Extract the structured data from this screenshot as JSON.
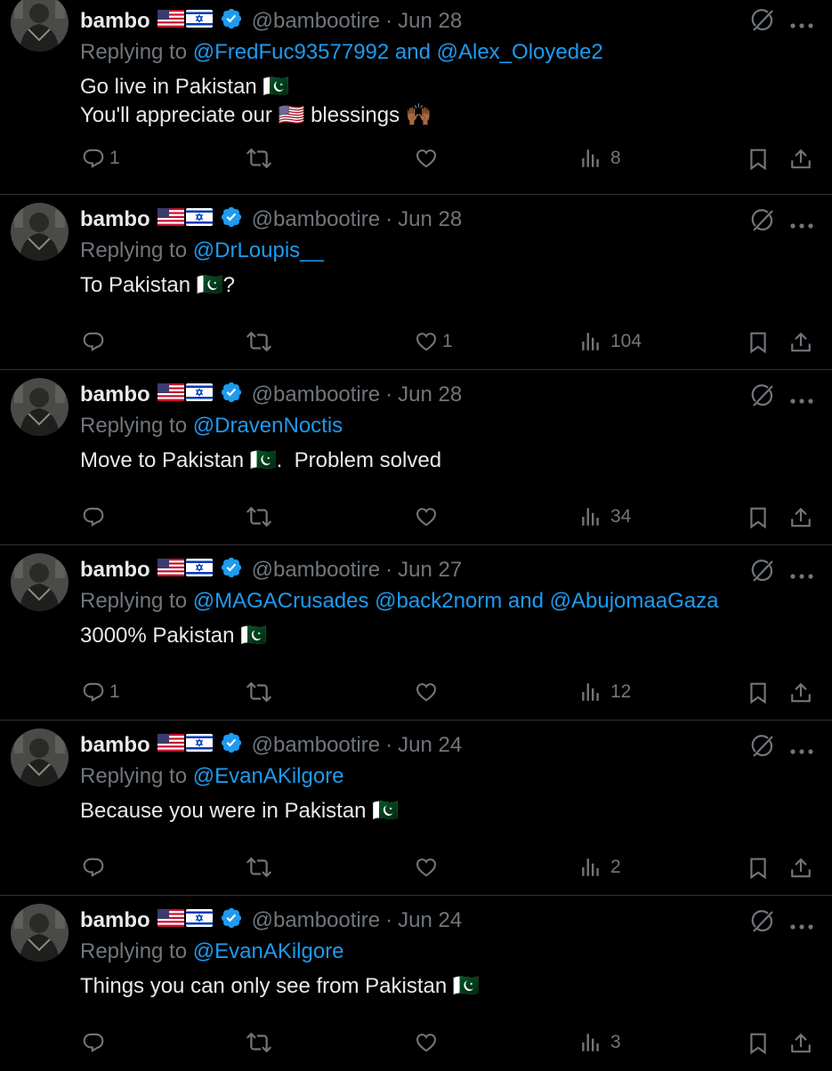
{
  "tweets": [
    {
      "name": "bambo",
      "handle": "@bambootire",
      "separator": "·",
      "date": "Jun 28",
      "replying_prefix": "Replying to",
      "replying_to": "@FredFuc93577992 and @Alex_Oloyede2",
      "body_lines": [
        "Go live in Pakistan 🇵🇰",
        "You'll appreciate our 🇺🇸 blessings 🙌🏾"
      ],
      "counts": {
        "replies": "1",
        "retweets": "",
        "likes": "",
        "views": "8"
      }
    },
    {
      "name": "bambo",
      "handle": "@bambootire",
      "separator": "·",
      "date": "Jun 28",
      "replying_prefix": "Replying to",
      "replying_to": "@DrLoupis__",
      "body_lines": [
        "To Pakistan 🇵🇰?"
      ],
      "counts": {
        "replies": "",
        "retweets": "",
        "likes": "1",
        "views": "104"
      }
    },
    {
      "name": "bambo",
      "handle": "@bambootire",
      "separator": "·",
      "date": "Jun 28",
      "replying_prefix": "Replying to",
      "replying_to": "@DravenNoctis",
      "body_lines": [
        "Move to Pakistan 🇵🇰.  Problem solved"
      ],
      "counts": {
        "replies": "",
        "retweets": "",
        "likes": "",
        "views": "34"
      }
    },
    {
      "name": "bambo",
      "handle": "@bambootire",
      "separator": "·",
      "date": "Jun 27",
      "replying_prefix": "Replying to",
      "replying_to": "@MAGACrusades @back2norm and @AbujomaaGaza",
      "body_lines": [
        "3000% Pakistan 🇵🇰"
      ],
      "counts": {
        "replies": "1",
        "retweets": "",
        "likes": "",
        "views": "12"
      }
    },
    {
      "name": "bambo",
      "handle": "@bambootire",
      "separator": "·",
      "date": "Jun 24",
      "replying_prefix": "Replying to",
      "replying_to": "@EvanAKilgore",
      "body_lines": [
        "Because you were in Pakistan 🇵🇰"
      ],
      "counts": {
        "replies": "",
        "retweets": "",
        "likes": "",
        "views": "2"
      }
    },
    {
      "name": "bambo",
      "handle": "@bambootire",
      "separator": "·",
      "date": "Jun 24",
      "replying_prefix": "Replying to",
      "replying_to": "@EvanAKilgore",
      "body_lines": [
        "Things you can only see from Pakistan 🇵🇰"
      ],
      "counts": {
        "replies": "",
        "retweets": "",
        "likes": "",
        "views": "3"
      }
    }
  ],
  "icons": {
    "verified": "verified-badge-icon",
    "flags": [
      "us-flag-icon",
      "israel-flag-icon"
    ],
    "grok": "grok-icon",
    "more": "more-icon",
    "reply": "reply-icon",
    "retweet": "retweet-icon",
    "like": "like-icon",
    "views": "views-icon",
    "bookmark": "bookmark-icon",
    "share": "share-icon"
  },
  "colors": {
    "background": "#000000",
    "text": "#e7e9ea",
    "muted": "#71767b",
    "link": "#1d9bf0",
    "divider": "#2f3336"
  }
}
